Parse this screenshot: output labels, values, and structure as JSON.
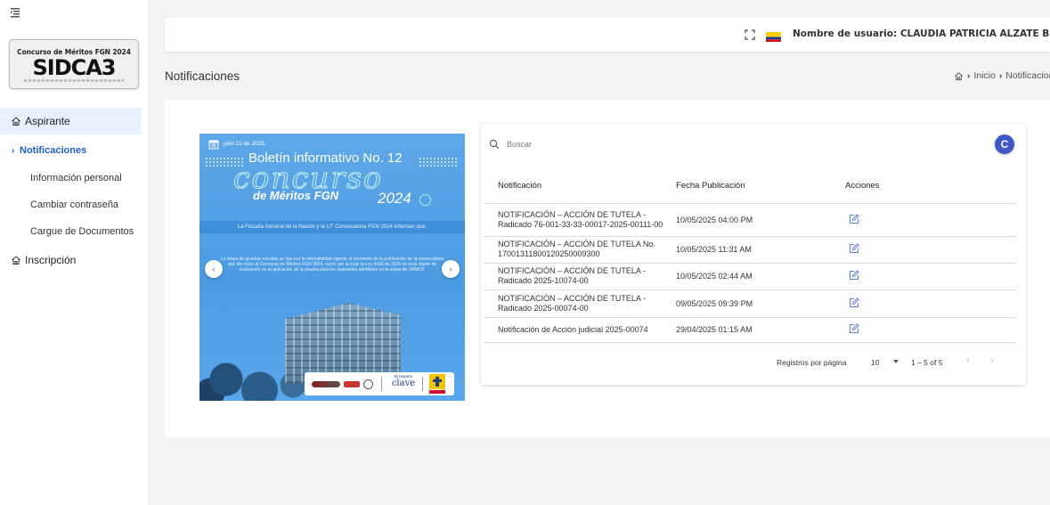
{
  "sidebar": {
    "logo_caption": "Concurso de Méritos FGN 2024",
    "logo_text": "SIDCA3",
    "groups": [
      {
        "label": "Aspirante"
      },
      {
        "label": "Inscripción"
      }
    ],
    "items": [
      {
        "label": "Notificaciones",
        "chevron": "›"
      },
      {
        "label": "Información personal"
      },
      {
        "label": "Cambiar contraseña"
      },
      {
        "label": "Cargue de Documentos"
      }
    ]
  },
  "header": {
    "user_label": "Nombre de usuario: CLAUDIA PATRICIA ALZATE BETANCUR",
    "flag_colors": [
      "#f7d117",
      "#1a3e9a",
      "#ce1126"
    ]
  },
  "page": {
    "title": "Notificaciones",
    "breadcrumb": [
      "Inicio",
      "Notificaciones"
    ],
    "breadcrumb_sep": "›"
  },
  "banner": {
    "date": "julio 21 de 2025.",
    "title": "Boletín informativo No. 12",
    "script": "concurso",
    "subtitle": "de Méritos FGN",
    "year": "2024",
    "strip": "La Fiscalía General de la Nación y la UT Convocatoria FGN 2024 informan que:",
    "body": "La etapa de pruebas escritas se rige por la normatividad vigente al momento de la publicación de la convocatoria que dio inicio al Concurso de Méritos FGN 2024, razón por la cual, la Ley 2439 de 2025 no será objeto de evaluación en la aplicación de la prueba para los aspirantes admitidos en la etapa de VRMCP.",
    "prev": "‹",
    "next": "›",
    "clave_small": "El respeto",
    "clave_big": "clave"
  },
  "table": {
    "search_placeholder": "Buscar",
    "refresh_glyph": "C",
    "columns": [
      "Notificación",
      "Fecha Publicación",
      "Acciones"
    ],
    "rows": [
      {
        "notificacion": "NOTIFICACIÓN – ACCIÓN DE TUTELA - Radicado 76-001-33-33-00017-2025-00111-00",
        "fecha": "10/05/2025 04:00 PM"
      },
      {
        "notificacion": "NOTIFICACIÓN – ACCIÓN DE TUTELA No. 17001311800120250009300",
        "fecha": "10/05/2025 11:31 AM"
      },
      {
        "notificacion": "NOTIFICACIÓN – ACCIÓN DE TUTELA - Radicado 2025-10074-00",
        "fecha": "10/05/2025 02:44 AM"
      },
      {
        "notificacion": "NOTIFICACIÓN – ACCIÓN DE TUTELA - Radicado 2025-00074-00",
        "fecha": "09/05/2025 09:39 PM"
      },
      {
        "notificacion": "Notificación de Acción judicial 2025-00074",
        "fecha": "29/04/2025 01:15 AM"
      }
    ],
    "pager": {
      "label": "Registros por página",
      "page_size": "10",
      "range": "1 – 5 of 5",
      "prev": "‹",
      "next": "›"
    }
  },
  "icons": {
    "sidebar_toggle": "menu-collapse-icon",
    "group_icon": "home-icon",
    "fullscreen": "fullscreen-icon",
    "flag": "colombia-flag-icon",
    "search": "search-icon",
    "refresh": "refresh-icon",
    "edit": "edit-icon"
  },
  "colors": {
    "accent": "#1e5fcf",
    "refresh_button": "#3e57c9",
    "banner_blue": "#4c9be2"
  }
}
